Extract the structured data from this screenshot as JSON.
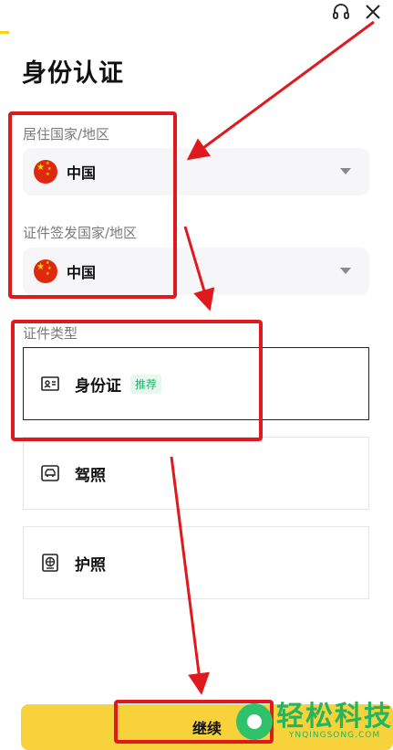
{
  "header": {
    "title": "身份认证"
  },
  "residence": {
    "label": "居住国家/地区",
    "value": "中国"
  },
  "issuing": {
    "label": "证件签发国家/地区",
    "value": "中国"
  },
  "doc_type": {
    "label": "证件类型",
    "options": [
      {
        "label": "身份证",
        "badge": "推荐",
        "icon": "id-card-icon",
        "selected": true
      },
      {
        "label": "驾照",
        "icon": "car-icon",
        "selected": false
      },
      {
        "label": "护照",
        "icon": "passport-icon",
        "selected": false
      }
    ]
  },
  "continue_label": "继续",
  "watermark": {
    "main": "轻松科技",
    "sub": "YNQINGSONG.COM"
  },
  "colors": {
    "accent": "#f7d23a",
    "annotation": "#e0191e",
    "badge": "#20b26c"
  }
}
